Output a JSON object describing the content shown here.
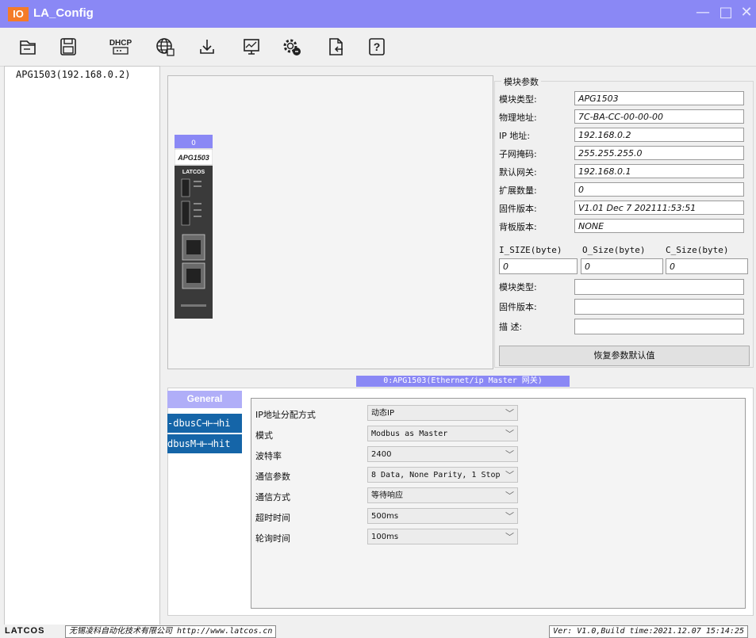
{
  "window": {
    "logo": "IO",
    "title": "LA_Config",
    "accent": "#8a88f5",
    "logo_color": "#f47b28"
  },
  "toolbar": {
    "buttons": [
      "open-file-icon",
      "save-icon",
      "dhcp-icon",
      "network-scan-icon",
      "download-icon",
      "monitor-icon",
      "settings-icon",
      "export-icon",
      "help-icon"
    ],
    "dhcp_label": "DHCP",
    "help_glyph": "?"
  },
  "tree": {
    "items": [
      {
        "label": "APG1503(192.168.0.2)"
      }
    ]
  },
  "device": {
    "slot": "0",
    "model": "APG1503",
    "brand": "LATCOS"
  },
  "params": {
    "group_title": "模块参数",
    "rows": [
      {
        "label": "模块类型:",
        "value": "APG1503"
      },
      {
        "label": "物理地址:",
        "value": "7C-BA-CC-00-00-00"
      },
      {
        "label": "IP 地址:",
        "value": "192.168.0.2"
      },
      {
        "label": "子网掩码:",
        "value": "255.255.255.0"
      },
      {
        "label": "默认网关:",
        "value": "192.168.0.1"
      },
      {
        "label": "扩展数量:",
        "value": "0"
      },
      {
        "label": "固件版本:",
        "value": "V1.01 Dec  7 202111:53:51"
      },
      {
        "label": "背板版本:",
        "value": "NONE"
      }
    ],
    "size_headers": [
      "I_SIZE(byte)",
      "O_Size(byte)",
      "C_Size(byte)"
    ],
    "size_values": [
      "0",
      "0",
      "0"
    ],
    "extra_rows": [
      {
        "label": "模块类型:",
        "value": ""
      },
      {
        "label": "固件版本:",
        "value": ""
      },
      {
        "label": "描    述:",
        "value": ""
      }
    ],
    "reset_button": "恢复参数默认值"
  },
  "selected_module": "0:APG1503(Ethernet/ip Master 网关)",
  "tabs": {
    "general": "General",
    "side": [
      "-dbusC⊣⊢⊣hi",
      "dbusM⊣⊢⊣hit"
    ]
  },
  "form": {
    "fields": [
      {
        "label": "IP地址分配方式",
        "value": "动态IP"
      },
      {
        "label": "模式",
        "value": "Modbus as Master"
      },
      {
        "label": "波特率",
        "value": "2400"
      },
      {
        "label": "通信参数",
        "value": "8 Data, None Parity, 1 Stop"
      },
      {
        "label": "通信方式",
        "value": "等待响应"
      },
      {
        "label": "超时时间",
        "value": "500ms"
      },
      {
        "label": "轮询时间",
        "value": "100ms"
      }
    ]
  },
  "status": {
    "brand": "LATCOS",
    "company": "无锡凌科自动化技术有限公司 http://www.latcos.cn",
    "version": "Ver: V1.0,Build time:2021.12.07 15:14:25"
  }
}
